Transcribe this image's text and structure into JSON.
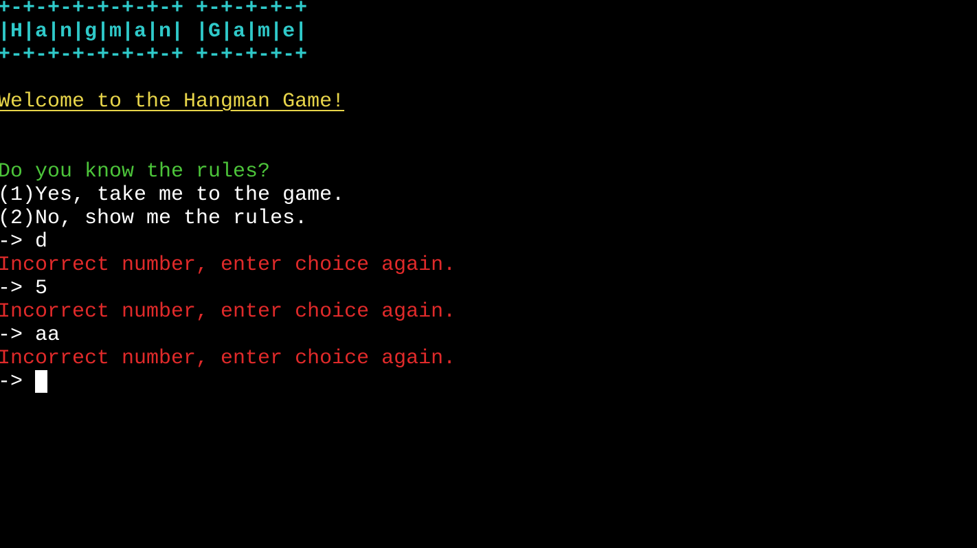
{
  "banner": {
    "top_border": "+-+-+-+-+-+-+-+ +-+-+-+-+",
    "title_row": "|H|a|n|g|m|a|n| |G|a|m|e|",
    "bottom_border": "+-+-+-+-+-+-+-+ +-+-+-+-+"
  },
  "welcome": "Welcome to the Hangman Game!",
  "question": "Do you know the rules?",
  "options": [
    "(1)Yes, take me to the game.",
    "(2)No, show me the rules."
  ],
  "history": [
    {
      "input": "-> d",
      "error": "Incorrect number, enter choice again."
    },
    {
      "input": "-> 5",
      "error": "Incorrect number, enter choice again."
    },
    {
      "input": "-> aa",
      "error": "Incorrect number, enter choice again."
    }
  ],
  "current_prompt": "-> ",
  "colors": {
    "background": "#000000",
    "banner": "#2fc9c9",
    "welcome": "#e8d54a",
    "question": "#4cc43a",
    "text": "#ffffff",
    "error": "#e02a2a"
  }
}
